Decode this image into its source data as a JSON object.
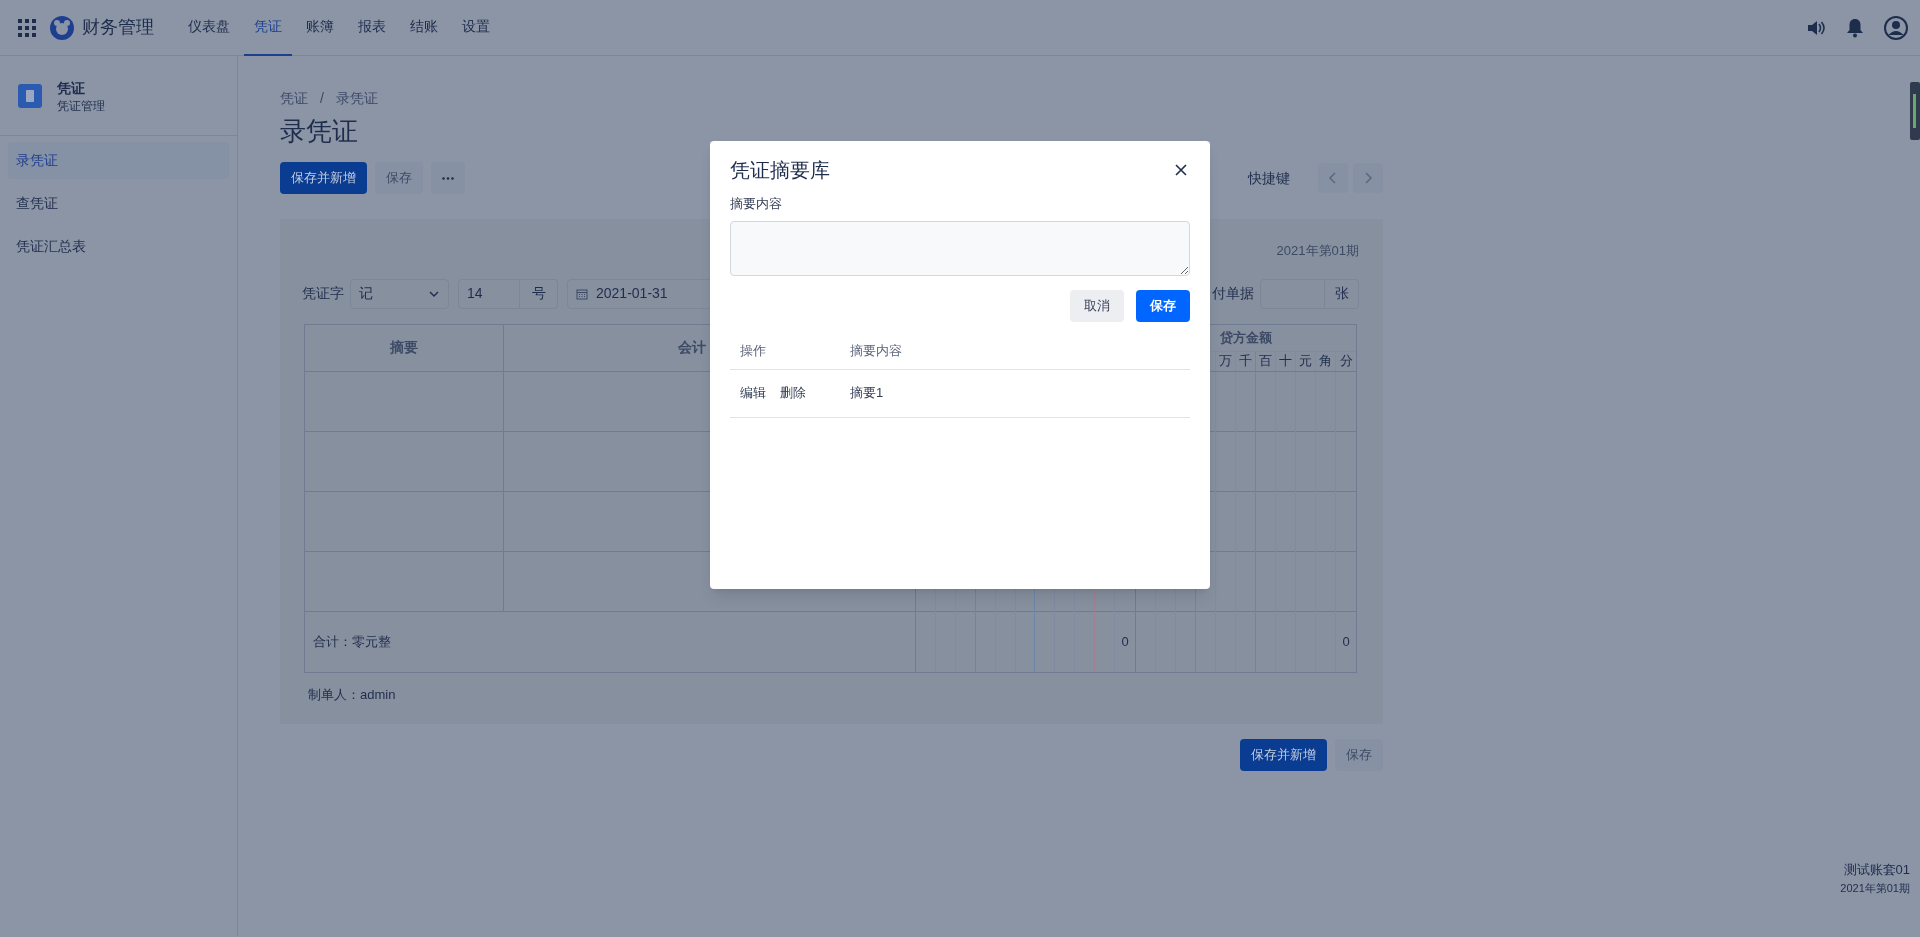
{
  "top_nav": {
    "app_name": "财务管理",
    "items": [
      {
        "label": "仪表盘",
        "selected": false
      },
      {
        "label": "凭证",
        "selected": true
      },
      {
        "label": "账簿",
        "selected": false
      },
      {
        "label": "报表",
        "selected": false
      },
      {
        "label": "结账",
        "selected": false
      },
      {
        "label": "设置",
        "selected": false
      }
    ]
  },
  "sidebar": {
    "title": "凭证",
    "subtitle": "凭证管理",
    "items": [
      {
        "label": "录凭证",
        "selected": true
      },
      {
        "label": "查凭证",
        "selected": false
      },
      {
        "label": "凭证汇总表",
        "selected": false
      }
    ]
  },
  "breadcrumb": [
    "凭证",
    "录凭证"
  ],
  "breadcrumb_separator": "/",
  "page_title": "录凭证",
  "toolbar": [
    {
      "kind": "primary",
      "label": "保存并新增"
    },
    {
      "kind": "secondary",
      "label": "保存"
    },
    {
      "kind": "more"
    }
  ],
  "shortcut_link": "快捷键",
  "voucher": {
    "period": "2021年第01期",
    "word_label": "凭证字",
    "word": "记",
    "number": "14",
    "number_suffix": "号",
    "date": "2021-01-31",
    "attachments_label": "付单据",
    "attachments_suffix": "张",
    "columns": [
      "摘要",
      "会计"
    ],
    "credit_header": "贷方金额",
    "credit_units": [
      "万",
      "千",
      "百",
      "十",
      "元",
      "角",
      "分"
    ],
    "totals": {
      "label": "合计：零元整",
      "debit": "0",
      "credit": "0"
    },
    "maker": "制单人：admin"
  },
  "bottom_buttons": [
    {
      "kind": "primary",
      "label": "保存并新增"
    },
    {
      "kind": "secondary",
      "label": "保存"
    }
  ],
  "footer": {
    "account": "测试账套01",
    "period": "2021年第01期"
  },
  "dialog": {
    "title": "凭证摘要库",
    "field_label": "摘要内容",
    "buttons": [
      {
        "kind": "secondary",
        "label": "取消"
      },
      {
        "kind": "primary",
        "label": "保存"
      }
    ],
    "columns": [
      "操作",
      "摘要内容"
    ],
    "rows": [
      {
        "actions": [
          "编辑",
          "删除"
        ],
        "content": "摘要1"
      }
    ]
  }
}
